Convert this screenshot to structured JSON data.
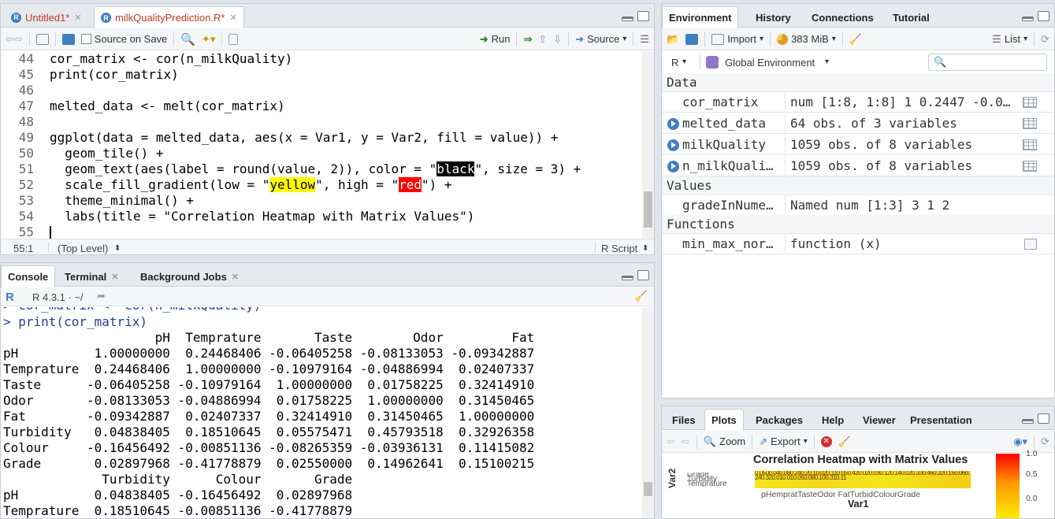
{
  "editor": {
    "tabs": [
      {
        "label": "Untitled1*"
      },
      {
        "label": "milkQualityPrediction.R*"
      }
    ],
    "toolbar": {
      "source_on_save": "Source on Save",
      "run": "Run",
      "source": "Source"
    },
    "lines": [
      {
        "num": "44",
        "text": "cor_matrix <- cor(n_milkQuality)"
      },
      {
        "num": "45",
        "text": "print(cor_matrix)"
      },
      {
        "num": "46",
        "text": ""
      },
      {
        "num": "47",
        "text": "melted_data <- melt(cor_matrix)"
      },
      {
        "num": "48",
        "text": ""
      },
      {
        "num": "49",
        "text": "ggplot(data = melted_data, aes(x = Var1, y = Var2, fill = value)) +"
      },
      {
        "num": "50",
        "text": "  geom_tile() +"
      },
      {
        "num": "51",
        "pre": "  geom_text(aes(label = round(value, 2)), color = \"",
        "hl": "black",
        "post": "\", size = 3) +"
      },
      {
        "num": "52",
        "pre": "  scale_fill_gradient(low = \"",
        "hl": "yellow",
        "mid": "\", high = \"",
        "hl2": "red",
        "post": "\") +"
      },
      {
        "num": "53",
        "text": "  theme_minimal() +"
      },
      {
        "num": "54",
        "text": "  labs(title = \"Correlation Heatmap with Matrix Values\")"
      },
      {
        "num": "55",
        "text": ""
      }
    ],
    "status": {
      "position": "55:1",
      "scope": "(Top Level)",
      "filetype": "R Script"
    }
  },
  "console": {
    "tabs": [
      {
        "label": "Console"
      },
      {
        "label": "Terminal"
      },
      {
        "label": "Background Jobs"
      }
    ],
    "version": "R 4.3.1 · ~/",
    "lines": [
      {
        "text": "> cor_matrix <- cor(n_milkQuality)",
        "cmd": true
      },
      {
        "text": "> print(cor_matrix)",
        "cmd": true
      },
      {
        "text": "                    pH  Temprature       Taste        Odor         Fat"
      },
      {
        "text": "pH          1.00000000  0.24468406 -0.06405258 -0.08133053 -0.09342887"
      },
      {
        "text": "Temprature  0.24468406  1.00000000 -0.10979164 -0.04886994  0.02407337"
      },
      {
        "text": "Taste      -0.06405258 -0.10979164  1.00000000  0.01758225  0.32414910"
      },
      {
        "text": "Odor       -0.08133053 -0.04886994  0.01758225  1.00000000  0.31450465"
      },
      {
        "text": "Fat        -0.09342887  0.02407337  0.32414910  0.31450465  1.00000000"
      },
      {
        "text": "Turbidity   0.04838405  0.18510645  0.05575471  0.45793518  0.32926358"
      },
      {
        "text": "Colour     -0.16456492 -0.00851136 -0.08265359 -0.03936131  0.11415082"
      },
      {
        "text": "Grade       0.02897968 -0.41778879  0.02550000  0.14962641  0.15100215"
      },
      {
        "text": "             Turbidity      Colour       Grade"
      },
      {
        "text": "pH          0.04838405 -0.16456492  0.02897968"
      },
      {
        "text": "Temprature  0.18510645 -0.00851136 -0.41778879"
      }
    ]
  },
  "environment": {
    "tabs": [
      {
        "label": "Environment"
      },
      {
        "label": "History"
      },
      {
        "label": "Connections"
      },
      {
        "label": "Tutorial"
      }
    ],
    "toolbar": {
      "import": "Import",
      "memory": "383 MiB",
      "view": "List"
    },
    "lang": "R",
    "scope": "Global Environment",
    "search_placeholder": "",
    "sections": {
      "data": "Data",
      "values": "Values",
      "functions": "Functions"
    },
    "data_rows": [
      {
        "name": "cor_matrix",
        "value": "num [1:8, 1:8] 1 0.2447 -0.0…",
        "expandable": false
      },
      {
        "name": "melted_data",
        "value": "64 obs. of 3 variables",
        "expandable": true
      },
      {
        "name": "milkQuality",
        "value": "1059 obs. of 8 variables",
        "expandable": true
      },
      {
        "name": "n_milkQuali…",
        "value": "1059 obs. of 8 variables",
        "expandable": true
      }
    ],
    "value_rows": [
      {
        "name": "gradeInNume…",
        "value": "Named num [1:3] 3 1 2"
      }
    ],
    "function_rows": [
      {
        "name": "min_max_nor…",
        "value": "function (x)"
      }
    ]
  },
  "files": {
    "tabs": [
      {
        "label": "Files"
      },
      {
        "label": "Plots"
      },
      {
        "label": "Packages"
      },
      {
        "label": "Help"
      },
      {
        "label": "Viewer"
      },
      {
        "label": "Presentation"
      }
    ],
    "toolbar": {
      "zoom": "Zoom",
      "export": "Export"
    },
    "plot": {
      "title": "Correlation Heatmap with Matrix Values",
      "xlabel": "Var1",
      "ylabel": "Var2",
      "xticks": "pHempratTasteOdor  FatTurbidColourGrade",
      "legend_ticks": [
        "1.0",
        "0.5",
        "0.0"
      ]
    }
  },
  "colors": {
    "accent": "#3f7fbf",
    "pane_border": "#c6ccd2",
    "hl_yellow": "#ffff00",
    "hl_red": "#ff0000"
  }
}
